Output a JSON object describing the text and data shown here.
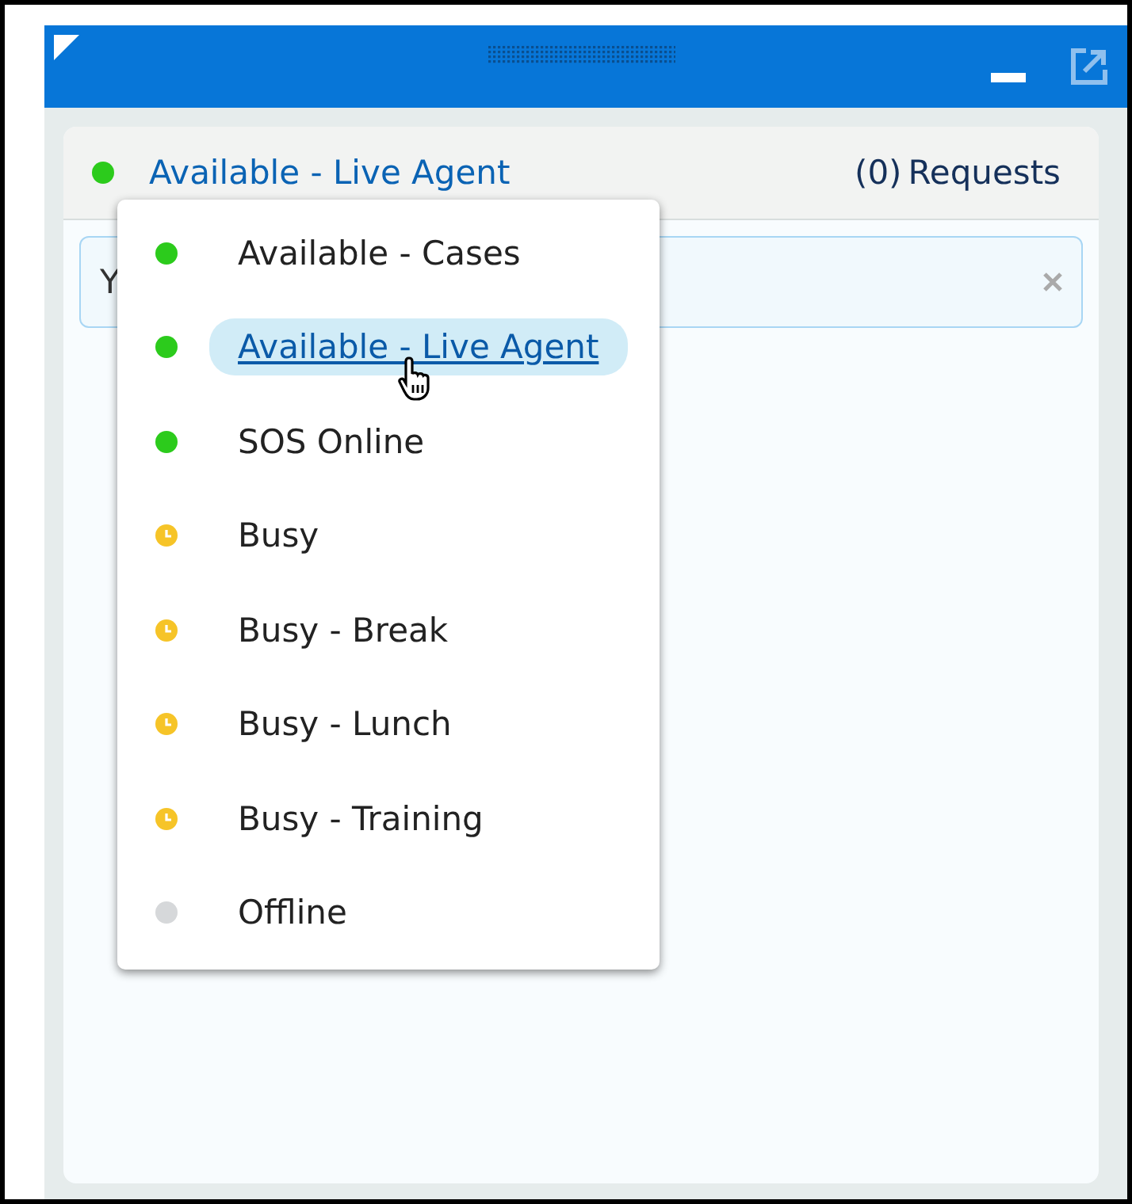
{
  "status_bar": {
    "status": "Available - Live Agent",
    "kind": "available",
    "requests_count": "(0)",
    "requests_label": "Requests"
  },
  "notice": {
    "text": "Y"
  },
  "status_menu": {
    "items": [
      {
        "label": "Available - Cases",
        "kind": "available",
        "selected": false
      },
      {
        "label": "Available - Live Agent",
        "kind": "available",
        "selected": true
      },
      {
        "label": "SOS Online",
        "kind": "available",
        "selected": false
      },
      {
        "label": "Busy",
        "kind": "busy",
        "selected": false
      },
      {
        "label": "Busy - Break",
        "kind": "busy",
        "selected": false
      },
      {
        "label": "Busy - Lunch",
        "kind": "busy",
        "selected": false
      },
      {
        "label": "Busy - Training",
        "kind": "busy",
        "selected": false
      },
      {
        "label": "Offline",
        "kind": "offline",
        "selected": false
      }
    ]
  }
}
